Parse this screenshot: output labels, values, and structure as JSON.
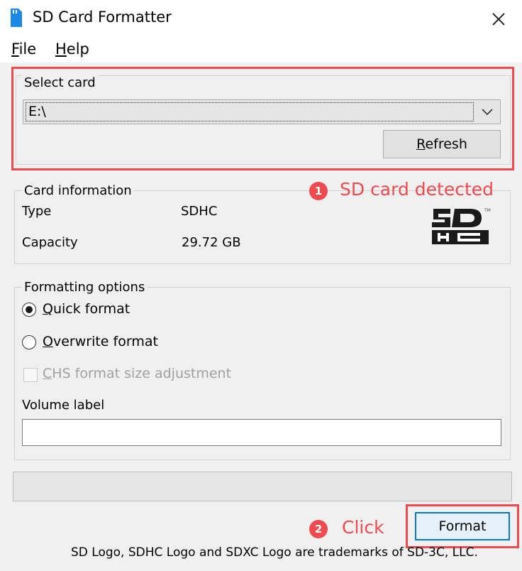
{
  "window": {
    "title": "SD Card Formatter"
  },
  "menu": {
    "file_underline": "F",
    "file_rest": "ile",
    "help_underline": "H",
    "help_rest": "elp"
  },
  "select_card": {
    "group_label": "Select card",
    "selected_value": "E:\\",
    "refresh_underline": "R",
    "refresh_rest": "efresh"
  },
  "card_info": {
    "group_label": "Card information",
    "type_label": "Type",
    "type_value": "SDHC",
    "capacity_label": "Capacity",
    "capacity_value": "29.72 GB",
    "logo": "sdhc-logo"
  },
  "formatting": {
    "group_label": "Formatting options",
    "quick_underline": "Q",
    "quick_rest": "uick format",
    "quick_selected": true,
    "overwrite_underline": "O",
    "overwrite_rest": "verwrite format",
    "overwrite_selected": false,
    "chs_underline": "C",
    "chs_rest": "HS format size adjustment",
    "chs_enabled": false,
    "volume_label_title": "Volume label",
    "volume_label_value": ""
  },
  "progress": {
    "fraction": 0
  },
  "actions": {
    "format_label": "Format"
  },
  "annotations": {
    "step1_number": "1",
    "step1_text": "SD card detected",
    "step2_number": "2",
    "step2_text": "Click",
    "color": "#ef4a4f"
  },
  "footer": {
    "text": "SD Logo, SDHC Logo and SDXC Logo are trademarks of SD-3C, LLC."
  }
}
